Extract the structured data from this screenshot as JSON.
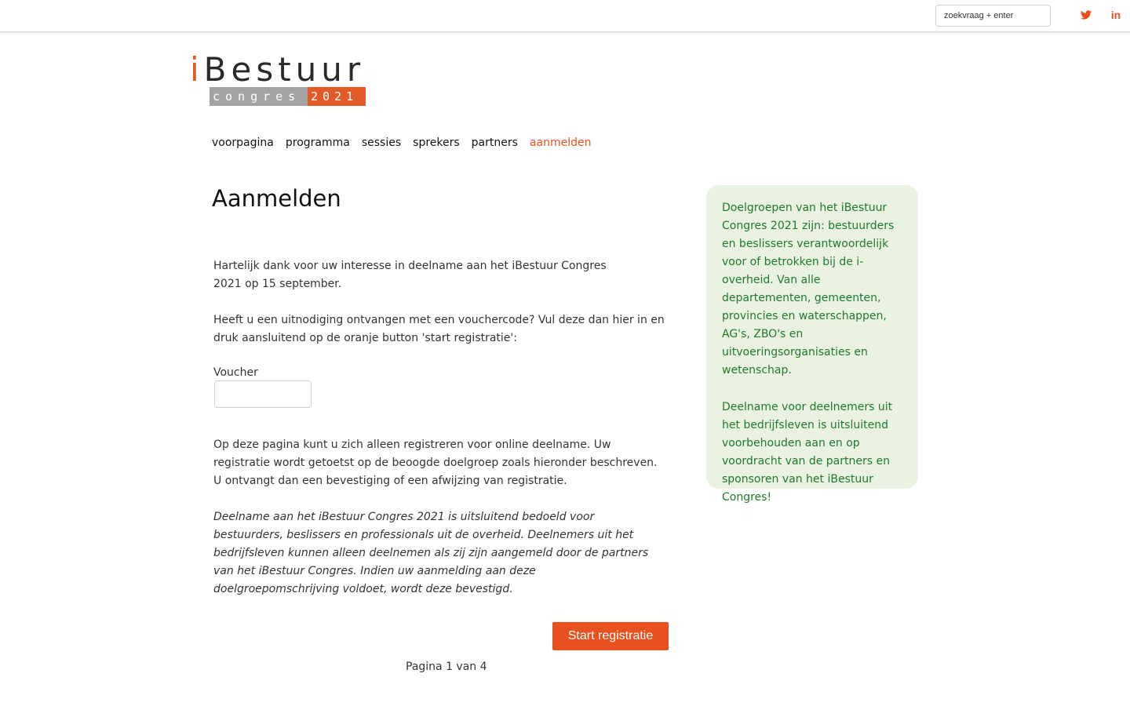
{
  "topbar": {
    "search_placeholder": "zoekvraag + enter",
    "twitter_icon": "twitter-icon",
    "linkedin_label": "in"
  },
  "logo": {
    "i": "i",
    "main": "Bestuur",
    "congres": "congres",
    "year": "2021"
  },
  "nav": {
    "items": [
      "voorpagina",
      "programma",
      "sessies",
      "sprekers",
      "partners",
      "aanmelden"
    ],
    "active": "aanmelden"
  },
  "page_title": "Aanmelden",
  "main": {
    "p1": "Hartelijk dank voor uw interesse in deelname aan het iBestuur Congres 2021 op 15 september.",
    "p2": "Heeft u een uitnodiging ontvangen met een vouchercode? Vul deze dan hier in en druk aansluitend op de oranje button 'start registratie':",
    "voucher_label": "Voucher",
    "voucher_value": "",
    "p3": "Op deze pagina kunt u zich alleen registreren voor online deelname. Uw registratie wordt getoetst op de beoogde doelgroep zoals hieronder beschreven. U ontvangt dan een bevestiging of een afwijzing van registratie.",
    "p4": "Deelname aan het iBestuur Congres 2021 is uitsluitend bedoeld voor bestuurders, beslissers en professionals uit de overheid. Deelnemers uit het bedrijfsleven kunnen alleen deelnemen als zij zijn aangemeld door de partners van het iBestuur Congres. Indien uw aanmelding aan deze doelgroepomschrijving voldoet, wordt deze bevestigd."
  },
  "start_button": "Start registratie",
  "pager": "Pagina 1 van 4",
  "aside": {
    "p1": "Doelgroepen van het iBestuur Congres 2021 zijn: bestuurders en beslissers verantwoordelijk voor of betrokken bij de i-overheid. Van alle departementen, gemeenten, provincies en waterschappen, AG's, ZBO's en uitvoeringsorganisaties en wetenschap.",
    "p2": "Deelname voor deelnemers uit het bedrijfsleven is uitsluitend voorbehouden aan en op voordracht van de partners en sponsoren van het iBestuur Congres!"
  },
  "colors": {
    "accent": "#e8511e",
    "aside_bg": "#eaf3e2",
    "aside_text": "#1f7a2a"
  }
}
